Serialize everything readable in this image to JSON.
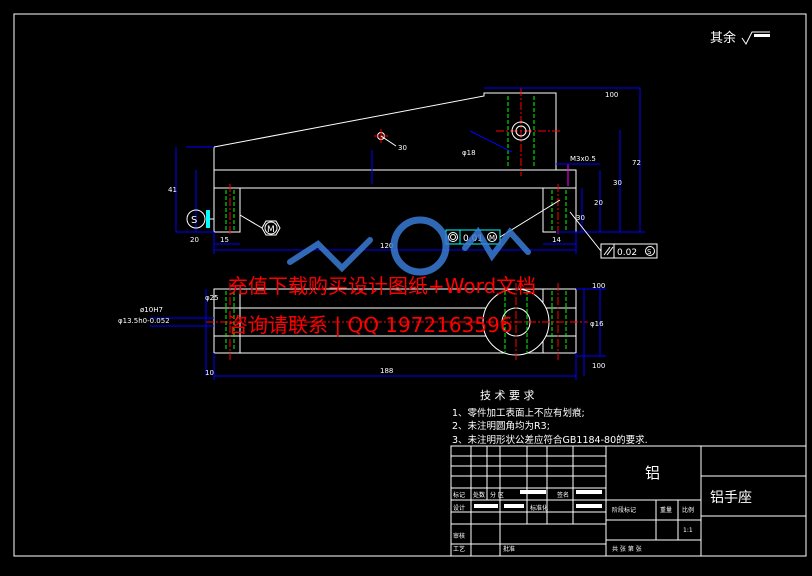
{
  "surface_finish": {
    "label": "其余"
  },
  "dimensions": {
    "d_top_width": "100",
    "d_right_height": "72",
    "d_right_height2": "30",
    "d_right_h3": "20",
    "d_right_h4": "30",
    "d_thread": "M3x0.5",
    "d_hole": "φ18",
    "d_angle": "30",
    "d_left_height": "41",
    "d_lower_left_w": "15",
    "d_lower_right_w": "14",
    "d_overall": "120",
    "d_side_small": "20",
    "d_bottom_overall": "188",
    "d_plan_left_a": "ø10H7",
    "d_plan_left_b": "φ13.5h0-0.052",
    "d_plan_right": "φ16",
    "d_plan_w": "100",
    "d_misc_a": "10",
    "d_misc_b": "100",
    "d_circ": "φ25"
  },
  "tolerance_frames": {
    "position_value": "0.01",
    "position_modifier": "M",
    "parallel_value": "0.02",
    "parallel_modifier": "S"
  },
  "datum_labels": {
    "s": "S",
    "m": "M"
  },
  "watermark": {
    "line1": "充值下载购买设计图纸+Word文档",
    "line2": "咨询请联系 | QQ 1972163596"
  },
  "requirements": {
    "title": "技 术 要 求",
    "items": [
      "1、零件加工表面上不应有划痕;",
      "2、未注明圆角均为R3;",
      "3、未注明形状公差应符合GB1184-80的要求."
    ]
  },
  "title_block": {
    "material": "铝",
    "part_name": "铝手座",
    "labels": {
      "mark": "标记",
      "count": "处数",
      "zone": "分 区",
      "sign": "签名",
      "design": "设计",
      "standard": "标准化",
      "stage_mark": "阶段标记",
      "weight": "重量",
      "scale": "比例",
      "scale_value": "1:1",
      "review": "审核",
      "process": "工艺",
      "approve": "批准",
      "sheets": "共  张  第  张"
    }
  },
  "colors": {
    "outline": "#ffffff",
    "dimension": "#0000ff",
    "center": "#ff0000",
    "hidden": "#00ff00",
    "leader": "#ff00ff",
    "watermark": "#ff0000",
    "logo": "#3a7bd5"
  }
}
